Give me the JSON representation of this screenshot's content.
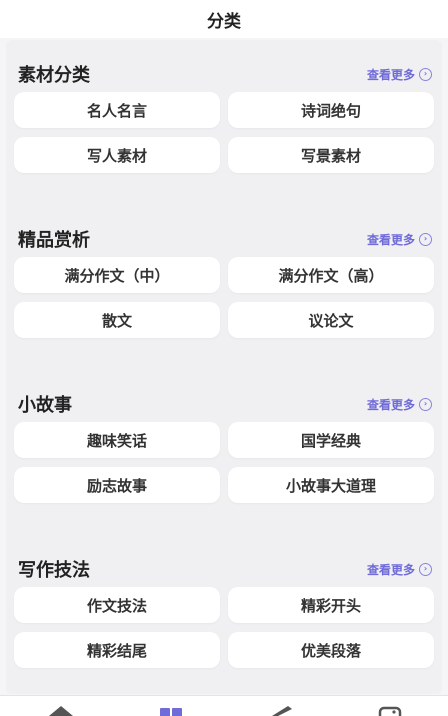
{
  "header": {
    "title": "分类"
  },
  "sections": [
    {
      "title": "素材分类",
      "more_label": "查看更多",
      "items": [
        "名人名言",
        "诗词绝句",
        "写人素材",
        "写景素材"
      ]
    },
    {
      "title": "精品赏析",
      "more_label": "查看更多",
      "items": [
        "满分作文（中）",
        "满分作文（高）",
        "散文",
        "议论文"
      ]
    },
    {
      "title": "小故事",
      "more_label": "查看更多",
      "items": [
        "趣味笑话",
        "国学经典",
        "励志故事",
        "小故事大道理"
      ]
    },
    {
      "title": "写作技法",
      "more_label": "查看更多",
      "items": [
        "作文技法",
        "精彩开头",
        "精彩结尾",
        "优美段落"
      ]
    }
  ],
  "tabbar": {
    "icons": [
      "home-icon",
      "category-icon",
      "pen-icon",
      "profile-icon"
    ],
    "active_color": "#6f6bd8",
    "inactive_color": "#555555"
  }
}
